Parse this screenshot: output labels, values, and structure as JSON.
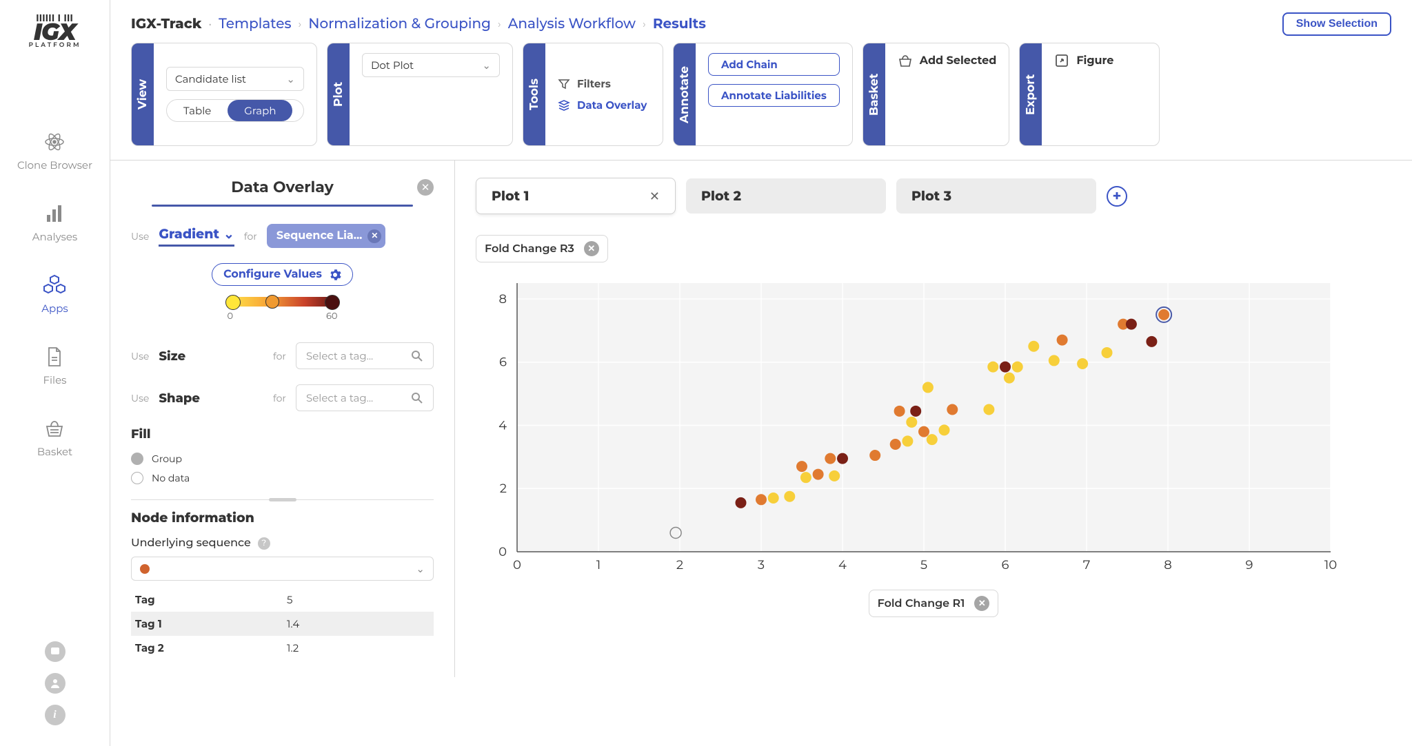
{
  "brand": {
    "name": "IGX",
    "sub": "PLATFORM"
  },
  "rail": {
    "items": [
      {
        "id": "clone-browser",
        "label": "Clone Browser"
      },
      {
        "id": "analyses",
        "label": "Analyses"
      },
      {
        "id": "apps",
        "label": "Apps"
      },
      {
        "id": "files",
        "label": "Files"
      },
      {
        "id": "basket",
        "label": "Basket"
      }
    ],
    "active": "apps"
  },
  "breadcrumb": {
    "app": "IGX-Track",
    "path": [
      "Templates",
      "Normalization & Grouping",
      "Analysis Workflow"
    ],
    "current": "Results",
    "show_selection": "Show Selection"
  },
  "toolbar": {
    "view": {
      "tab": "View",
      "select": "Candidate list",
      "toggle": {
        "left": "Table",
        "right": "Graph",
        "active": "right"
      }
    },
    "plot": {
      "tab": "Plot",
      "select": "Dot Plot"
    },
    "tools": {
      "tab": "Tools",
      "filters": "Filters",
      "overlay": "Data Overlay"
    },
    "annotate": {
      "tab": "Annotate",
      "add_chain": "Add Chain",
      "annotate": "Annotate Liabilities"
    },
    "basket": {
      "tab": "Basket",
      "add": "Add Selected"
    },
    "export": {
      "tab": "Export",
      "figure": "Figure"
    }
  },
  "sidebar": {
    "title": "Data Overlay",
    "use": "Use",
    "for": "for",
    "gradient_label": "Gradient",
    "chip": "Sequence Lia...",
    "configure": "Configure Values",
    "grad_min": "0",
    "grad_max": "60",
    "size_label": "Size",
    "shape_label": "Shape",
    "tag_placeholder": "Select a tag...",
    "fill": "Fill",
    "legend": [
      {
        "label": "Group",
        "fill": "#b0b0b0"
      },
      {
        "label": "No data",
        "fill": "#ffffff"
      }
    ],
    "node_info": "Node information",
    "underlying": "Underlying sequence",
    "kv": [
      {
        "k": "Tag",
        "v": "5"
      },
      {
        "k": "Tag 1",
        "v": "1.4"
      },
      {
        "k": "Tag 2",
        "v": "1.2"
      }
    ]
  },
  "plots": {
    "tabs": [
      {
        "label": "Plot 1",
        "closable": true
      },
      {
        "label": "Plot 2",
        "closable": false
      },
      {
        "label": "Plot 3",
        "closable": false
      }
    ],
    "active": 0,
    "y_chip": "Fold Change R3",
    "x_chip": "Fold Change R1"
  },
  "chart_data": {
    "type": "scatter",
    "xlabel": "Fold Change R1",
    "ylabel": "Fold Change R3",
    "xlim": [
      0,
      10
    ],
    "ylim": [
      0,
      8.5
    ],
    "xticks": [
      0,
      1,
      2,
      3,
      4,
      5,
      6,
      7,
      8,
      9,
      10
    ],
    "yticks": [
      0,
      2,
      4,
      6,
      8
    ],
    "colors": {
      "low": "#f7cf3a",
      "mid": "#e07a30",
      "high": "#7a2016"
    },
    "points": [
      {
        "x": 1.95,
        "y": 0.6,
        "c": "none"
      },
      {
        "x": 2.75,
        "y": 1.55,
        "c": "high"
      },
      {
        "x": 3.0,
        "y": 1.65,
        "c": "mid"
      },
      {
        "x": 3.15,
        "y": 1.7,
        "c": "low"
      },
      {
        "x": 3.35,
        "y": 1.75,
        "c": "low"
      },
      {
        "x": 3.5,
        "y": 2.7,
        "c": "mid"
      },
      {
        "x": 3.55,
        "y": 2.35,
        "c": "low"
      },
      {
        "x": 3.7,
        "y": 2.45,
        "c": "mid"
      },
      {
        "x": 3.85,
        "y": 2.95,
        "c": "mid"
      },
      {
        "x": 3.9,
        "y": 2.4,
        "c": "low"
      },
      {
        "x": 4.0,
        "y": 2.95,
        "c": "high"
      },
      {
        "x": 4.4,
        "y": 3.05,
        "c": "mid"
      },
      {
        "x": 4.65,
        "y": 3.4,
        "c": "mid"
      },
      {
        "x": 4.7,
        "y": 4.45,
        "c": "mid"
      },
      {
        "x": 4.8,
        "y": 3.5,
        "c": "low"
      },
      {
        "x": 4.85,
        "y": 4.1,
        "c": "low"
      },
      {
        "x": 4.9,
        "y": 4.45,
        "c": "high"
      },
      {
        "x": 5.0,
        "y": 3.8,
        "c": "mid"
      },
      {
        "x": 5.05,
        "y": 5.2,
        "c": "low"
      },
      {
        "x": 5.1,
        "y": 3.55,
        "c": "low"
      },
      {
        "x": 5.25,
        "y": 3.85,
        "c": "low"
      },
      {
        "x": 5.35,
        "y": 4.5,
        "c": "mid"
      },
      {
        "x": 5.8,
        "y": 4.5,
        "c": "low"
      },
      {
        "x": 5.85,
        "y": 5.85,
        "c": "low"
      },
      {
        "x": 6.0,
        "y": 5.85,
        "c": "high"
      },
      {
        "x": 6.05,
        "y": 5.5,
        "c": "low"
      },
      {
        "x": 6.15,
        "y": 5.85,
        "c": "low"
      },
      {
        "x": 6.35,
        "y": 6.5,
        "c": "low"
      },
      {
        "x": 6.6,
        "y": 6.05,
        "c": "low"
      },
      {
        "x": 6.7,
        "y": 6.7,
        "c": "mid"
      },
      {
        "x": 6.95,
        "y": 5.95,
        "c": "low"
      },
      {
        "x": 7.25,
        "y": 6.3,
        "c": "low"
      },
      {
        "x": 7.45,
        "y": 7.2,
        "c": "mid"
      },
      {
        "x": 7.55,
        "y": 7.2,
        "c": "high"
      },
      {
        "x": 7.8,
        "y": 6.65,
        "c": "high"
      },
      {
        "x": 7.95,
        "y": 7.5,
        "c": "mid",
        "selected": true
      }
    ]
  }
}
